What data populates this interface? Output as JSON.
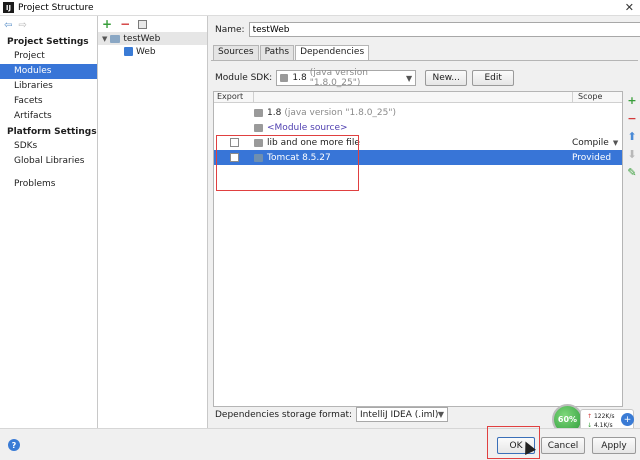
{
  "window": {
    "title": "Project Structure",
    "app_icon": "IJ"
  },
  "left_nav": {
    "project_settings_header": "Project Settings",
    "project_settings": [
      "Project",
      "Modules",
      "Libraries",
      "Facets",
      "Artifacts"
    ],
    "platform_settings_header": "Platform Settings",
    "platform_settings": [
      "SDKs",
      "Global Libraries"
    ],
    "other": [
      "Problems"
    ],
    "selected": "Modules"
  },
  "tree": {
    "root": "testWeb",
    "child": "Web"
  },
  "module": {
    "name_label": "Name:",
    "name_value": "testWeb",
    "tabs": [
      "Sources",
      "Paths",
      "Dependencies"
    ],
    "active_tab": "Dependencies",
    "sdk_label": "Module SDK:",
    "sdk_value": "1.8",
    "sdk_detail": "(java version \"1.8.0_25\")",
    "new_label": "New...",
    "edit_label": "Edit"
  },
  "dependencies": {
    "headers": {
      "export": "Export",
      "scope": "Scope"
    },
    "rows": [
      {
        "name": "1.8",
        "detail": "(java version \"1.8.0_25\")",
        "scope": "",
        "checkbox": false
      },
      {
        "name": "<Module source>",
        "detail": "",
        "scope": "",
        "checkbox": false
      },
      {
        "name": "lib and one more file",
        "detail": "",
        "scope": "Compile",
        "checkbox": true
      },
      {
        "name": "Tomcat 8.5.27",
        "detail": "",
        "scope": "Provided",
        "checkbox": true,
        "selected": true
      }
    ]
  },
  "storage": {
    "label": "Dependencies storage format:",
    "value": "IntelliJ IDEA (.iml)"
  },
  "buttons": {
    "ok": "OK",
    "cancel": "Cancel",
    "apply": "Apply",
    "help": "?"
  },
  "widget": {
    "percent": "60%",
    "up": "122K/s",
    "down": "4.1K/s"
  },
  "colors": {
    "selection": "#3875d7",
    "highlight_box": "#e04040"
  }
}
